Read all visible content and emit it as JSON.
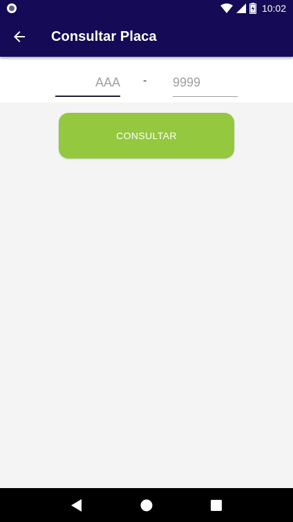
{
  "status_bar": {
    "time": "10:02",
    "icons": [
      "notification-icon",
      "wifi-icon",
      "signal-icon",
      "battery-icon"
    ]
  },
  "app_bar": {
    "title": "Consultar Placa",
    "back_icon": "arrow-back-icon",
    "background_color": "#150a55"
  },
  "form": {
    "letters_placeholder": "AAA",
    "letters_value": "",
    "separator": "-",
    "numbers_placeholder": "9999",
    "numbers_value": ""
  },
  "actions": {
    "consult_label": "CONSULTAR",
    "consult_color": "#93c83f"
  },
  "nav_bar": {
    "icons": [
      "nav-back-icon",
      "nav-home-icon",
      "nav-recents-icon"
    ]
  }
}
